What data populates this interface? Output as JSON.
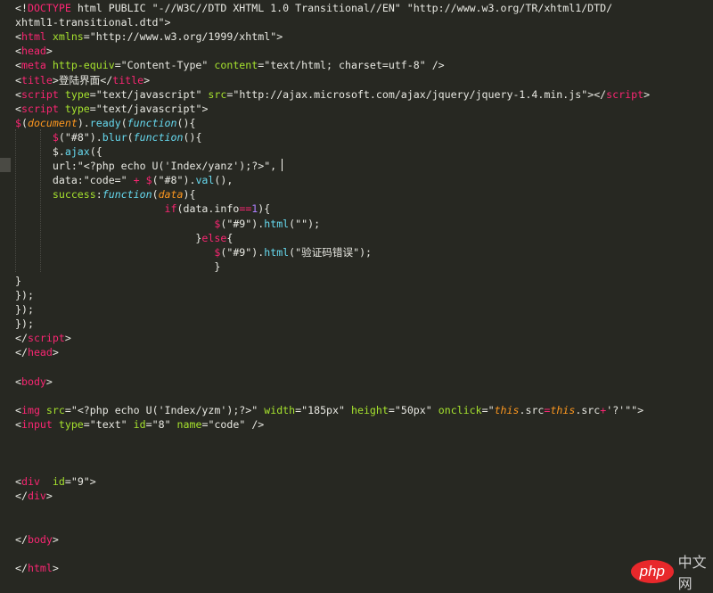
{
  "editor": {
    "lines": [
      [
        [
          "p",
          "<!"
        ],
        [
          "t",
          "DOCTYPE"
        ],
        [
          "p",
          " html PUBLIC \"-//W3C//DTD XHTML 1.0 Transitional//EN\" \"http://www.w3.org/TR/xhtml1/DTD/"
        ]
      ],
      [
        [
          "p",
          "xhtml1-transitional.dtd\">"
        ]
      ],
      [
        [
          "p",
          "<"
        ],
        [
          "t",
          "html"
        ],
        [
          "a",
          " xmlns"
        ],
        [
          "p",
          "="
        ],
        [
          "s",
          "\"http://www.w3.org/1999/xhtml\""
        ],
        [
          "p",
          ">"
        ]
      ],
      [
        [
          "p",
          "<"
        ],
        [
          "t",
          "head"
        ],
        [
          "p",
          ">"
        ]
      ],
      [
        [
          "p",
          "<"
        ],
        [
          "t",
          "meta"
        ],
        [
          "a",
          " http-equiv"
        ],
        [
          "p",
          "="
        ],
        [
          "s",
          "\"Content-Type\""
        ],
        [
          "a",
          " content"
        ],
        [
          "p",
          "="
        ],
        [
          "s",
          "\"text/html; charset=utf-8\""
        ],
        [
          "p",
          " />"
        ]
      ],
      [
        [
          "p",
          "<"
        ],
        [
          "t",
          "title"
        ],
        [
          "p",
          ">登陆界面</"
        ],
        [
          "t",
          "title"
        ],
        [
          "p",
          ">"
        ]
      ],
      [
        [
          "p",
          "<"
        ],
        [
          "t",
          "script"
        ],
        [
          "a",
          " type"
        ],
        [
          "p",
          "="
        ],
        [
          "s",
          "\"text/javascript\""
        ],
        [
          "a",
          " src"
        ],
        [
          "p",
          "="
        ],
        [
          "s",
          "\"http://ajax.microsoft.com/ajax/jquery/jquery-1.4.min.js\""
        ],
        [
          "p",
          "></"
        ],
        [
          "t",
          "script"
        ],
        [
          "p",
          ">"
        ]
      ],
      [
        [
          "p",
          "<"
        ],
        [
          "t",
          "script"
        ],
        [
          "a",
          " type"
        ],
        [
          "p",
          "="
        ],
        [
          "s",
          "\"text/javascript\""
        ],
        [
          "p",
          ">"
        ]
      ],
      [
        [
          "k",
          "$"
        ],
        [
          "p",
          "("
        ],
        [
          "o",
          "document"
        ],
        [
          "p",
          ")."
        ],
        [
          "m",
          "ready"
        ],
        [
          "p",
          "("
        ],
        [
          "f",
          "function"
        ],
        [
          "p",
          "(){"
        ]
      ],
      [
        [
          "p",
          "      "
        ],
        [
          "k",
          "$"
        ],
        [
          "p",
          "(\"#8\")."
        ],
        [
          "m",
          "blur"
        ],
        [
          "p",
          "("
        ],
        [
          "f",
          "function"
        ],
        [
          "p",
          "(){"
        ]
      ],
      [
        [
          "p",
          "      $."
        ],
        [
          "m",
          "ajax"
        ],
        [
          "p",
          "({"
        ]
      ],
      [
        [
          "p",
          "      url:\"<?php echo U('Index/yanz');?>\","
        ]
      ],
      [
        [
          "p",
          "      data:\"code=\" "
        ],
        [
          "k",
          "+"
        ],
        [
          "p",
          " "
        ],
        [
          "k",
          "$"
        ],
        [
          "p",
          "(\"#8\")."
        ],
        [
          "m",
          "val"
        ],
        [
          "p",
          "(),"
        ]
      ],
      [
        [
          "p",
          "      "
        ],
        [
          "a",
          "success"
        ],
        [
          "p",
          ":"
        ],
        [
          "f",
          "function"
        ],
        [
          "p",
          "("
        ],
        [
          "o",
          "data"
        ],
        [
          "p",
          "){"
        ]
      ],
      [
        [
          "p",
          "                        "
        ],
        [
          "k",
          "if"
        ],
        [
          "p",
          "(data.info"
        ],
        [
          "k",
          "=="
        ],
        [
          "n",
          "1"
        ],
        [
          "p",
          "){"
        ]
      ],
      [
        [
          "p",
          "                                "
        ],
        [
          "k",
          "$"
        ],
        [
          "p",
          "(\"#9\")."
        ],
        [
          "m",
          "html"
        ],
        [
          "p",
          "(\"\");"
        ]
      ],
      [
        [
          "p",
          "                             }"
        ],
        [
          "k",
          "else"
        ],
        [
          "p",
          "{"
        ]
      ],
      [
        [
          "p",
          "                                "
        ],
        [
          "k",
          "$"
        ],
        [
          "p",
          "(\"#9\")."
        ],
        [
          "m",
          "html"
        ],
        [
          "p",
          "(\"验证码错误\");"
        ]
      ],
      [
        [
          "p",
          "                                }"
        ]
      ],
      [
        [
          "p",
          "}"
        ]
      ],
      [
        [
          "p",
          "});"
        ]
      ],
      [
        [
          "p",
          "});"
        ]
      ],
      [
        [
          "p",
          "});"
        ]
      ],
      [
        [
          "p",
          "</"
        ],
        [
          "t",
          "script"
        ],
        [
          "p",
          ">"
        ]
      ],
      [
        [
          "p",
          "</"
        ],
        [
          "t",
          "head"
        ],
        [
          "p",
          ">"
        ]
      ],
      [],
      [
        [
          "p",
          "<"
        ],
        [
          "t",
          "body"
        ],
        [
          "p",
          ">"
        ]
      ],
      [],
      [
        [
          "p",
          "<"
        ],
        [
          "t",
          "img"
        ],
        [
          "a",
          " src"
        ],
        [
          "p",
          "="
        ],
        [
          "s",
          "\"<?php echo U('Index/yzm');?>\""
        ],
        [
          "a",
          " width"
        ],
        [
          "p",
          "="
        ],
        [
          "s",
          "\"185px\""
        ],
        [
          "a",
          " height"
        ],
        [
          "p",
          "="
        ],
        [
          "s",
          "\"50px\""
        ],
        [
          "a",
          " onclick"
        ],
        [
          "p",
          "=\""
        ],
        [
          "o",
          "this"
        ],
        [
          "p",
          ".src"
        ],
        [
          "k",
          "="
        ],
        [
          "o",
          "this"
        ],
        [
          "p",
          ".src"
        ],
        [
          "k",
          "+"
        ],
        [
          "p",
          "'?'\"\">"
        ]
      ],
      [
        [
          "p",
          "<"
        ],
        [
          "t",
          "input"
        ],
        [
          "a",
          " type"
        ],
        [
          "p",
          "="
        ],
        [
          "s",
          "\"text\""
        ],
        [
          "a",
          " id"
        ],
        [
          "p",
          "="
        ],
        [
          "s",
          "\"8\""
        ],
        [
          "a",
          " name"
        ],
        [
          "p",
          "="
        ],
        [
          "s",
          "\"code\""
        ],
        [
          "p",
          " />"
        ]
      ],
      [],
      [],
      [],
      [
        [
          "p",
          "<"
        ],
        [
          "t",
          "div"
        ],
        [
          "a",
          "  id"
        ],
        [
          "p",
          "="
        ],
        [
          "s",
          "\"9\""
        ],
        [
          "p",
          ">"
        ]
      ],
      [
        [
          "p",
          "</"
        ],
        [
          "t",
          "div"
        ],
        [
          "p",
          ">"
        ]
      ],
      [],
      [],
      [
        [
          "p",
          "</"
        ],
        [
          "t",
          "body"
        ],
        [
          "p",
          ">"
        ]
      ],
      [],
      [
        [
          "p",
          "</"
        ],
        [
          "t",
          "html"
        ],
        [
          "p",
          ">"
        ]
      ]
    ]
  },
  "watermark": {
    "logo": "php",
    "text": "中文网"
  },
  "colors": {
    "background": "#272822",
    "tag": "#f92672",
    "attribute": "#a6e22e",
    "function": "#66d9ef",
    "parameter": "#fd971f",
    "number": "#ae81ff"
  }
}
